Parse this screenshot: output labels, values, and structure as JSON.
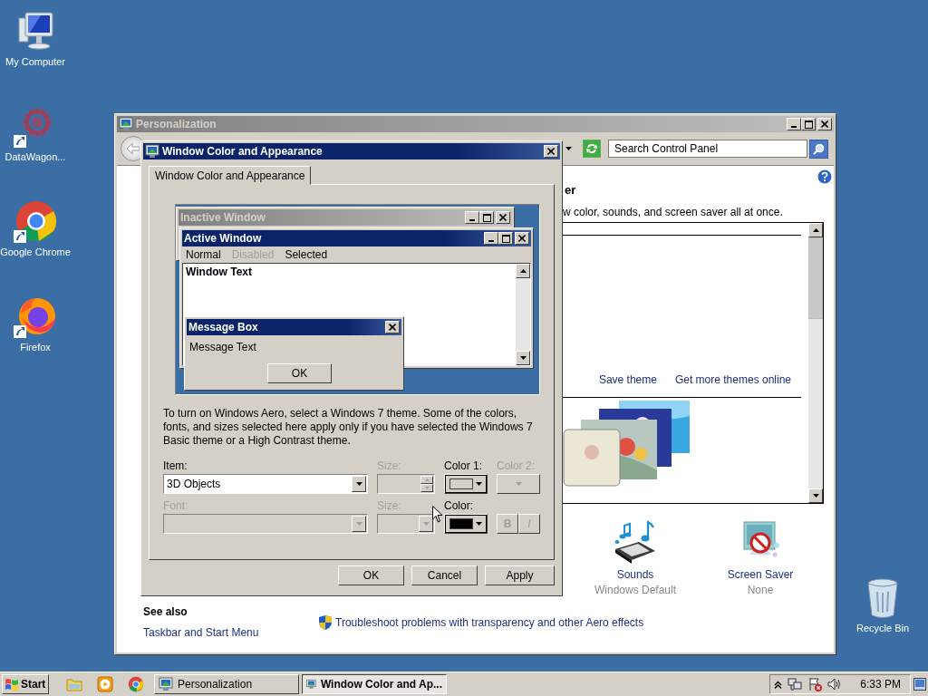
{
  "desktop_icons": [
    {
      "label": "My Computer",
      "kind": "computer"
    },
    {
      "label": "DataWagon...",
      "kind": "dots"
    },
    {
      "label": "Google Chrome",
      "kind": "ring"
    },
    {
      "label": "Firefox",
      "kind": "fox"
    }
  ],
  "recycle_bin": {
    "label": "Recycle Bin"
  },
  "personalization_window": {
    "title": "Personalization",
    "search": {
      "placeholder": "Search Control Panel"
    },
    "heading_fragment": "er",
    "description_fragment": "w color, sounds, and screen saver all at once.",
    "theme_links": [
      "Save theme",
      "Get more themes online"
    ],
    "settings": [
      {
        "label": "Sounds",
        "value": "Windows Default",
        "kind": "sounds"
      },
      {
        "label": "Screen Saver",
        "value": "None",
        "kind": "screensaver"
      }
    ],
    "see_also": {
      "heading": "See also",
      "links": [
        "Taskbar and Start Menu"
      ]
    },
    "troubleshoot_link": "Troubleshoot problems with transparency and other Aero effects"
  },
  "dialog": {
    "title": "Window Color and Appearance",
    "tabs": [
      {
        "label": "Window Color and Appearance",
        "selected": true
      }
    ],
    "preview": {
      "inactive_title": "Inactive Window",
      "active_title": "Active Window",
      "menu": [
        {
          "label": "Normal",
          "kind": "normal"
        },
        {
          "label": "Disabled",
          "kind": "disabled"
        },
        {
          "label": "Selected",
          "kind": "selected"
        }
      ],
      "window_text": "Window Text",
      "message_box": {
        "title": "Message Box",
        "text": "Message Text",
        "button": "OK"
      }
    },
    "info": "To turn on Windows Aero, select a Windows 7 theme.  Some of the colors, fonts, and sizes selected here apply only if you have selected the Windows 7 Basic theme or a High Contrast theme.",
    "fields": [
      {
        "kind": "combo",
        "label": "Item:",
        "value": "3D Objects",
        "disabled": false
      },
      {
        "kind": "spinner",
        "label": "Size:",
        "disabled": true
      },
      {
        "kind": "color",
        "label": "Color 1:",
        "color": "#d4d0c8",
        "disabled": false
      },
      {
        "kind": "color",
        "label": "Color 2:",
        "disabled": true
      },
      {
        "kind": "combo",
        "label": "Font:",
        "disabled": true
      },
      {
        "kind": "combo",
        "label": "Size:",
        "disabled": true
      },
      {
        "kind": "color",
        "label": "Color:",
        "color": "#000000",
        "disabled": false
      },
      {
        "kind": "style",
        "buttons": [
          {
            "label": "B",
            "kind": "bold",
            "disabled": true
          },
          {
            "label": "I",
            "kind": "italic",
            "disabled": true
          }
        ]
      }
    ],
    "buttons": [
      "OK",
      "Cancel",
      "Apply"
    ]
  },
  "taskbar": {
    "start": "Start",
    "quick_launch": [
      {
        "kind": "folder"
      },
      {
        "kind": "player"
      },
      {
        "kind": "ring"
      }
    ],
    "tasks": [
      {
        "label": "Personalization",
        "selected": false
      },
      {
        "label": "Window Color and Ap...",
        "selected": true
      }
    ],
    "clock": "6:33 PM"
  }
}
